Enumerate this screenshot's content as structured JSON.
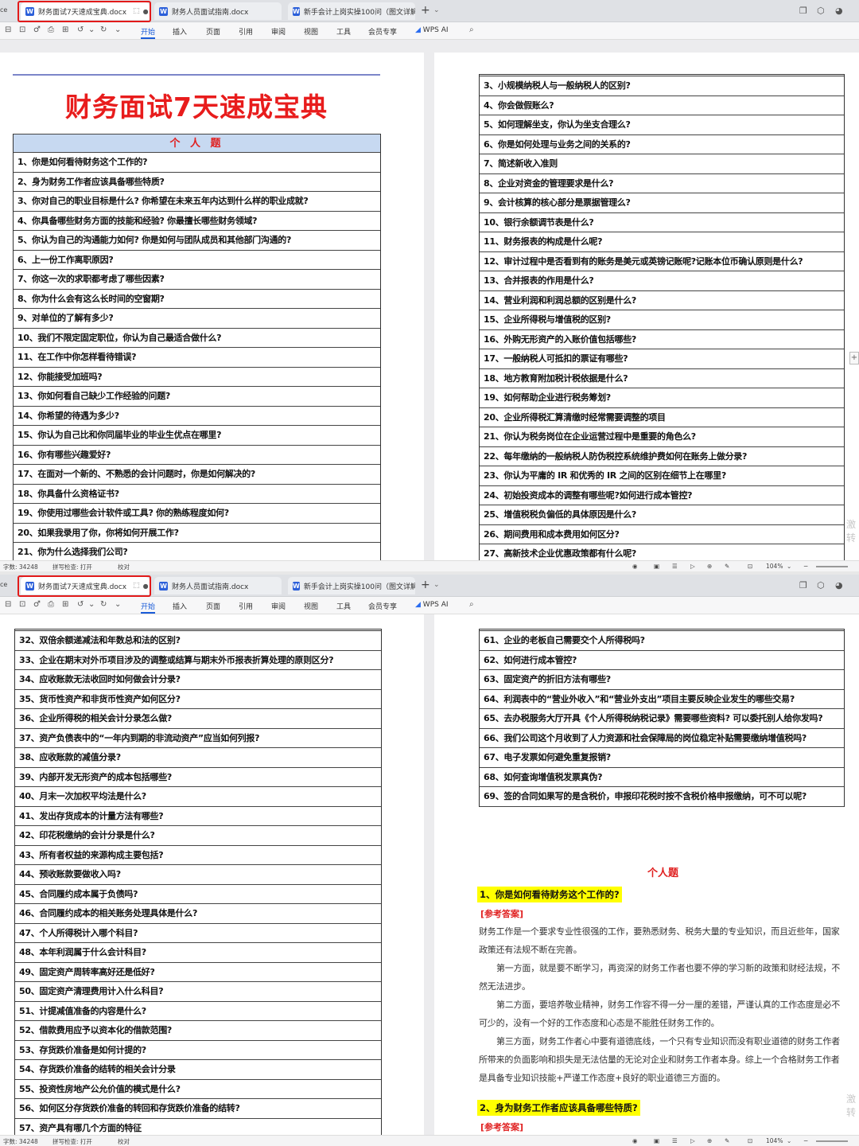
{
  "tabs": {
    "prefix": "ce",
    "active": "财务面试7天速成宝典.docx",
    "tab2": "财务人员面试指南.docx",
    "tab3": "新手会计上岗实操100问（图文详解）"
  },
  "toolbar": {
    "menus": [
      "开始",
      "插入",
      "页面",
      "引用",
      "审阅",
      "视图",
      "工具",
      "会员专享"
    ],
    "wps_ai": "WPS AI"
  },
  "status": {
    "wordcount": "字数: 34248",
    "spellcheck": "拼写检查: 打开",
    "proof": "校对",
    "zoom": "104%"
  },
  "doc": {
    "title": "财务面试7天速成宝典",
    "section_header": "个 人 题",
    "q_page1": [
      "1、你是如何看待财务这个工作的?",
      "2、身为财务工作者应该具备哪些特质?",
      "3、你对自己的职业目标是什么? 你希望在未来五年内达到什么样的职业成就?",
      "4、你具备哪些财务方面的技能和经验? 你最擅长哪些财务领域?",
      "5、你认为自己的沟通能力如何? 你是如何与团队成员和其他部门沟通的?",
      "6、上一份工作离职原因?",
      "7、你这一次的求职都考虑了哪些因素?",
      "8、你为什么会有这么长时间的空窗期?",
      "9、对单位的了解有多少?",
      "10、我们不限定固定职位，你认为自己最适合做什么?",
      "11、在工作中你怎样看待错误?",
      "12、你能接受加班吗?",
      "13、你如何看自己缺少工作经验的问题?",
      "14、你希望的待遇为多少?",
      "15、你认为自己比和你同届毕业的毕业生优点在哪里?",
      "16、你有哪些兴趣爱好?",
      "17、在面对一个新的、不熟悉的会计问题时，你是如何解决的?",
      "18、你具备什么资格证书?",
      "19、你使用过哪些会计软件或工具? 你的熟练程度如何?",
      "20、如果我录用了你，你将如何开展工作?",
      "21、你为什么选择我们公司?"
    ],
    "q_page2": [
      "3、小规模纳税人与一般纳税人的区别?",
      "4、你会做假账么?",
      "5、如何理解坐支，你认为坐支合理么?",
      "6、你是如何处理与业务之间的关系的?",
      "7、简述新收入准则",
      "8、企业对资金的管理要求是什么?",
      "9、会计核算的核心部分是票据管理么?",
      "10、银行余额调节表是什么?",
      "11、财务报表的构成是什么呢?",
      "12、审计过程中是否看到有的账务是美元或英镑记账呢?记账本位币确认原则是什么?",
      "13、合并报表的作用是什么?",
      "14、营业利润和利润总额的区别是什么?",
      "15、企业所得税与增值税的区别?",
      "16、外购无形资产的入账价值包括哪些?",
      "17、一般纳税人可抵扣的票证有哪些?",
      "18、地方教育附加税计税依据是什么?",
      "19、如何帮助企业进行税务筹划?",
      "20、企业所得税汇算清缴时经常需要调整的项目",
      "21、你认为税务岗位在企业运营过程中是重要的角色么?",
      "22、每年缴纳的一般纳税人防伪税控系统维护费如何在账务上做分录?",
      "23、你认为平庸的 IR 和优秀的 IR 之间的区别在细节上在哪里?",
      "24、初始投资成本的调整有哪些呢?如何进行成本管控?",
      "25、增值税税负偏低的具体原因是什么?",
      "26、期间费用和成本费用如何区分?",
      "27、高新技术企业优惠政策都有什么呢?"
    ],
    "q_page3": [
      "32、双倍余额递减法和年数总和法的区别?",
      "33、企业在期末对外币项目涉及的调整或结算与期末外币报表折算处理的原则区分?",
      "34、应收账款无法收回时如何做会计分录?",
      "35、货币性资产和非货币性资产如何区分?",
      "36、企业所得税的相关会计分录怎么做?",
      "37、资产负债表中的“一年内到期的非流动资产”应当如何列报?",
      "38、应收账款的减值分录?",
      "39、内部开发无形资产的成本包括哪些?",
      "40、月末一次加权平均法是什么?",
      "41、发出存货成本的计量方法有哪些?",
      "42、印花税缴纳的会计分录是什么?",
      "43、所有者权益的来源构成主要包括?",
      "44、预收账款要做收入吗?",
      "45、合同履约成本属于负债吗?",
      "46、合同履约成本的相关账务处理具体是什么?",
      "47、个人所得税计入哪个科目?",
      "48、本年利润属于什么会计科目?",
      "49、固定资产周转率高好还是低好?",
      "50、固定资产清理费用计入什么科目?",
      "51、计提减值准备的内容是什么?",
      "52、借款费用应予以资本化的借款范围?",
      "53、存货跌价准备是如何计提的?",
      "54、存货跌价准备的结转的相关会计分录",
      "55、投资性房地产公允价值的模式是什么?",
      "56、如何区分存货跌价准备的转回和存货跌价准备的结转?",
      "57、资产具有哪几个方面的特征"
    ],
    "q_page4": [
      "61、企业的老板自己需要交个人所得税吗?",
      "62、如何进行成本管控?",
      "63、固定资产的折旧方法有哪些?",
      "64、利润表中的“营业外收入”和“营业外支出”项目主要反映企业发生的哪些交易?",
      "65、去办税服务大厅开具《个人所得税纳税记录》需要哪些资料? 可以委托别人给你发吗?",
      "66、我们公司这个月收到了人力资源和社会保障局的岗位稳定补贴需要缴纳增值税吗?",
      "67、电子发票如何避免重复报销?",
      "68、如何查询增值税发票真伪?",
      "69、签的合同如果写的是含税价，申报印花税时按不含税价格申报缴纳，可不可以呢?"
    ],
    "answer_section": "个人题",
    "answer_q1": "1、你是如何看待财务这个工作的?",
    "answer_label": "[参考答案]",
    "answer_paras": [
      "财务工作是一个要求专业性很强的工作，要熟悉财务、税务大量的专业知识，而且近些年，国家政策还有法规不断在完善。",
      "第一方面，就是要不断学习，再资深的财务工作者也要不停的学习新的政策和财经法规，不然无法进步。",
      "第二方面，要培养敬业精神，财务工作容不得一分一厘的差错，严谨认真的工作态度是必不可少的，没有一个好的工作态度和心态是不能胜任财务工作的。",
      "第三方面，财务工作者心中要有道德底线，一个只有专业知识而没有职业道德的财务工作者所带来的负面影响和损失是无法估量的无论对企业和财务工作者本身。综上一个合格财务工作者是具备专业知识技能+严谨工作态度+良好的职业道德三方面的。"
    ],
    "answer_q2": "2、身为财务工作者应该具备哪些特质?",
    "answer_label2": "[参考答案]",
    "watermark": "激 转"
  },
  "colors": {
    "title_red": "#e81c1c",
    "header_blue": "#c7d9f1",
    "highlight": "#ffff00",
    "active_tab_border": "#e21a1a"
  }
}
